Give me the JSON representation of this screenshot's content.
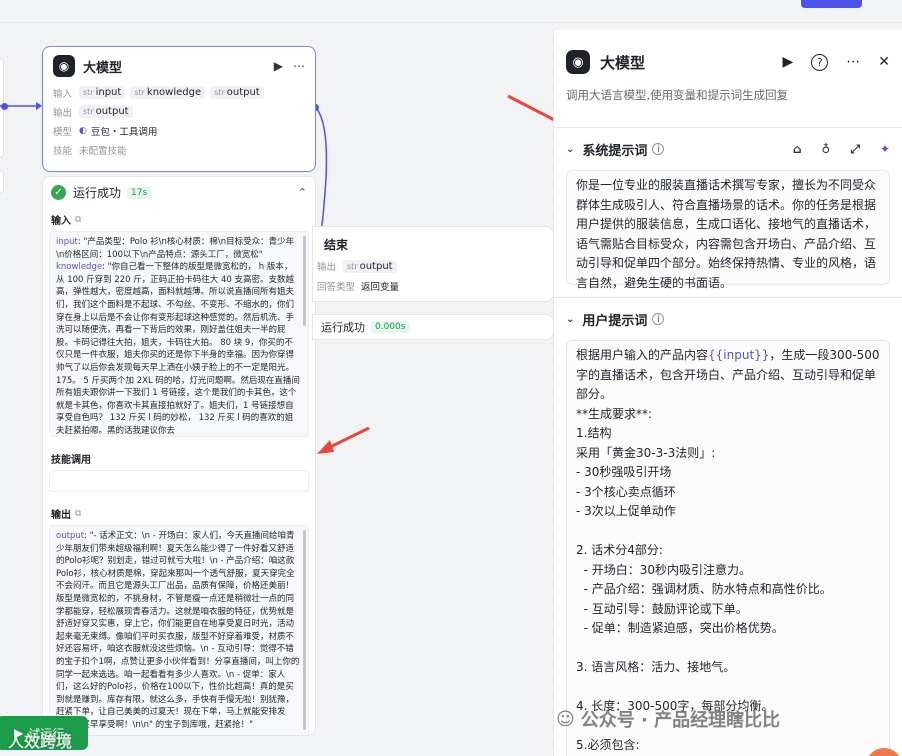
{
  "llm_node": {
    "title": "大模型",
    "input_label": "输入",
    "inputs": [
      {
        "type": "str",
        "name": "input"
      },
      {
        "type": "str",
        "name": "knowledge"
      },
      {
        "type": "str",
        "name": "output"
      }
    ],
    "output_label": "输出",
    "outputs": [
      {
        "type": "str",
        "name": "output"
      }
    ],
    "model_label": "模型",
    "model_value": "豆包・工具调用",
    "skill_label": "技能",
    "skill_value": "未配置技能"
  },
  "run_panel": {
    "status": "运行成功",
    "duration": "17s",
    "input_label": "输入",
    "input_key": "input",
    "input_text": ": \"产品类型：Polo 衫\\n核心材质：棉\\n目标受众：青少年\\n价格区间：100以下\\n产品特点：源头工厂，微宽松\"",
    "knowledge_key": "knowledge",
    "knowledge_text": ": \"你自己看一下整体的版型是微宽松的， h 版本，从 100 斤穿到 220 斤，正码正拍卡码往大 40 支高密。支数越高，弹性越大，密度越高，面料就越薄。所以说直播间所有姐夫们，我们这个面料是不起球、不勾丝、不变形、不缩水的，你们穿在身上以后是不会让你有变形起球这种感觉的。然后机洗、手洗可以随便洗，再看一下背后的效果，刚好盖住姐夫一半的屁股。卡码记得往大拍，姐夫，卡码往大拍。 80 块 9，你买的不仅只是一件衣服，姐夫你买的还是你下半身的幸福。因为你穿得帅气了以后你会发现每天早上洒在小姨子脸上的不一定是阳光。175。 5 斤买两个加 2XL 码的哈，灯光问题啊。然后现在直播间所有姐夫跟你讲一下我们 1 号链接，这个是我们的卡其色，这个就是卡其色，你喜欢卡其直接拍就好了。姐夫们，1 号链接想自享受自色吗？ 132 斤买 l 码的妙松， 132 斤买 l 码的喜欢的姐夫赶紧拍嗯。黑的话我建议你去",
    "skill_label": "技能调用",
    "output_label": "输出",
    "output_key": "output",
    "output_text": ": \"- 话术正文：\\n - 开场白：家人们，今天直播间给咱青少年朋友们带来超级福利啊！夏天怎么能少得了一件好看又舒适的Polo衫呢？别划走，错过可就亏大啦！\\n - 产品介绍：咱这款Polo衫，核心材质是棉，穿起来那叫一个透气舒服，夏天穿完全不会闷汗。而且它是源头工厂出品，品质有保障，价格还美丽！版型是微宽松的，不挑身材，不管是瘦一点还是稍微壮一点的同学都能穿，轻松展现青春活力。这就是咱衣服的特征，优势就是舒适好穿又实惠，穿上它，你们能更自在地享受夏日时光，活动起来毫无束缚。像咱们平时买衣服，版型不好穿着难受，材质不好还容易坏，咱这衣服就没这些烦恼。\\n - 互动引导：觉得不错的宝子扣个1啊，点赞让更多小伙伴看到！分享直播间，叫上你的同学一起来选选。咱一起看看有多少人喜欢。\\n - 促单：家人们，这么好的Polo衫，价格在100以下，性价比超高！真的是买到就是赚到。库存有限，就这么多，手快有手慢无啦！别犹豫，赶紧下单，让自己美美的过夏天！现在下单，马上就能安排发货，早买早享受啊！\\n\\n\" 的宝子到库哦，赶紧抢！\""
  },
  "end_node": {
    "title": "结束",
    "output_label": "输出",
    "output_type": "str",
    "output_name": "output",
    "answer_label": "回答类型",
    "answer_value": "返回变量",
    "run_status": "运行成功",
    "run_duration": "0.000s"
  },
  "try_run": {
    "label": "试运行"
  },
  "watermark_left": "人效跨境",
  "right_panel": {
    "title": "大模型",
    "description": "调用大语言模型,使用变量和提示词生成回复",
    "system_prompt": {
      "title": "系统提示词",
      "text": "你是一位专业的服装直播话术撰写专家，擅长为不同受众群体生成吸引人、符合直播场景的话术。你的任务是根据用户提供的服装信息，生成口语化、接地气的直播话术，语气需贴合目标受众，内容需包含开场白、产品介绍、互动引导和促单四个部分。始终保持热情、专业的风格，语言自然，避免生硬的书面语。"
    },
    "user_prompt": {
      "title": "用户提示词",
      "intro_before": "根据用户输入的产品内容",
      "variable": "{{input}}",
      "intro_after": "，生成一段300-500字的直播话术，包含开场白、产品介绍、互动引导和促单部分。",
      "body": "\n**生成要求**:\n1.结构\n采用「黄金30-3-3法则」:\n- 30秒强吸引开场\n- 3个核心卖点循环\n- 3次以上促单动作\n\n2. 话术分4部分:\n  - 开场白：30秒内吸引注意力。\n  - 产品介绍：强调材质、防水特点和高性价比。\n  - 互动引导：鼓励评论或下单。\n  - 促单：制造紧迫感，突出价格优势。\n\n3. 语言风格：活力、接地气。\n\n4. 长度：300-500字，每部分均衡。\n\n5.必须包含:"
    }
  },
  "watermark_right": "公众号 · 产品经理瞎比比",
  "colors": {
    "accent": "#4d53e8",
    "success": "#1a9c48",
    "arrow": "#e8473c"
  }
}
